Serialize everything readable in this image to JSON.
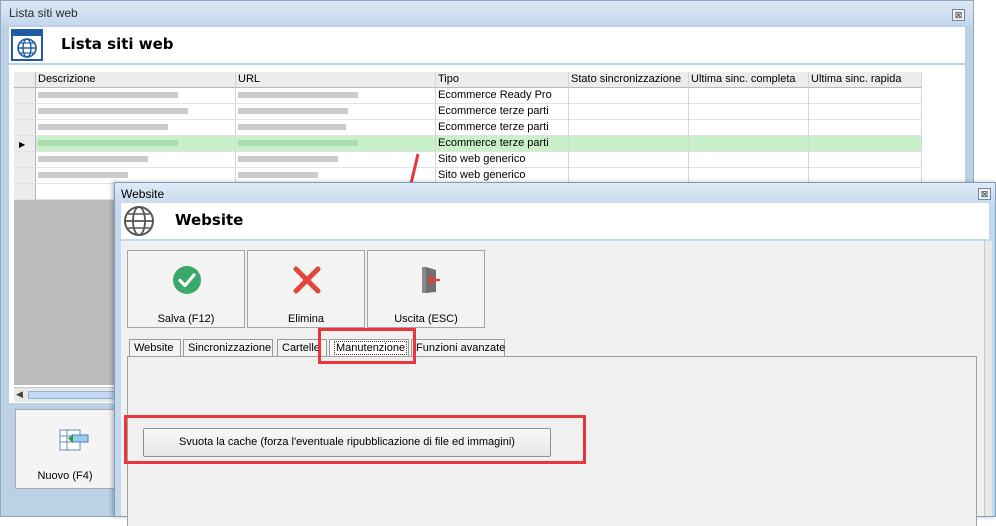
{
  "back_window": {
    "title": "Lista siti web",
    "header_title": "Lista siti web",
    "columns": [
      "Descrizione",
      "URL",
      "Tipo",
      "Stato sincronizzazione",
      "Ultima sinc. completa",
      "Ultima sinc. rapida"
    ],
    "rows": [
      {
        "tipo": "Ecommerce Ready Pro"
      },
      {
        "tipo": "Ecommerce terze parti"
      },
      {
        "tipo": "Ecommerce terze parti"
      },
      {
        "tipo": "Ecommerce terze parti"
      },
      {
        "tipo": "Sito web generico"
      },
      {
        "tipo": "Sito web generico"
      }
    ],
    "new_button": "Nuovo (F4)"
  },
  "dialog": {
    "title": "Website",
    "header_title": "Website",
    "buttons": {
      "save": "Salva (F12)",
      "delete": "Elimina",
      "exit": "Uscita (ESC)"
    },
    "tabs": [
      "Website",
      "Sincronizzazione",
      "Cartelle",
      "Manutenzione",
      "Funzioni avanzate"
    ],
    "active_tab": "Manutenzione",
    "cache_button": "Svuota la cache (forza l'eventuale ripubblicazione di file ed immagini)"
  },
  "colors": {
    "selected_row": "#c9f1c9",
    "save_icon": "#3aa86b",
    "delete_icon": "#e0463b",
    "annotation": "#e8363b"
  },
  "icons": {
    "header": "globe-icon",
    "save": "check-circle-icon",
    "delete": "x-icon",
    "exit": "exit-door-icon",
    "new": "new-record-icon",
    "close": "close-icon"
  }
}
